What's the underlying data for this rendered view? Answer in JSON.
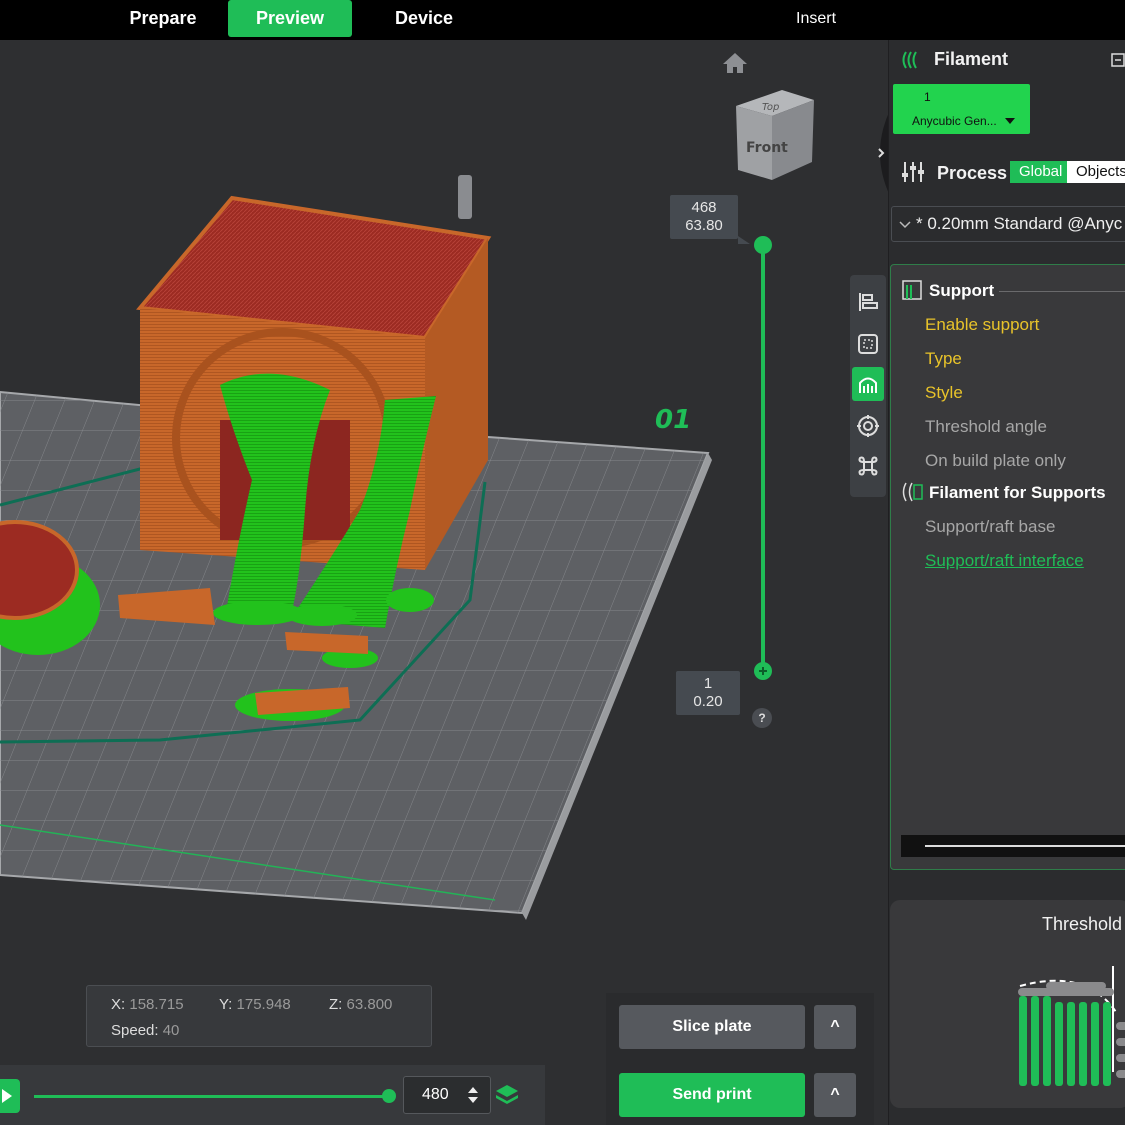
{
  "tabs": [
    {
      "label": "Prepare",
      "active": false
    },
    {
      "label": "Preview",
      "active": true
    },
    {
      "label": "Device",
      "active": false
    }
  ],
  "insert_label": "Insert",
  "viewcube": {
    "top": "Top",
    "front": "Front"
  },
  "plate_label": "01",
  "layer_slider": {
    "top_layer": "468",
    "top_height": "63.80",
    "bottom_layer": "1",
    "bottom_height": "0.20",
    "help": "?"
  },
  "coords": {
    "x_label": "X:",
    "x": "158.715",
    "y_label": "Y:",
    "y": "175.948",
    "z_label": "Z:",
    "z": "63.800",
    "speed_label": "Speed:",
    "speed": "40"
  },
  "playback": {
    "move_value": "480",
    "progress": 1.0
  },
  "buttons": {
    "slice": "Slice plate",
    "send": "Send print",
    "more": "^"
  },
  "filament": {
    "title": "Filament",
    "slot_number": "1",
    "slot_name": "Anycubic Gen..."
  },
  "process": {
    "title": "Process",
    "global": "Global",
    "objects": "Objects",
    "preset": "* 0.20mm Standard @Anyc"
  },
  "support": {
    "title": "Support",
    "options": [
      "Enable support",
      "Type",
      "Style",
      "Threshold angle",
      "On build plate only"
    ],
    "filament_title": "Filament for Supports",
    "filament_options": [
      "Support/raft base",
      "Support/raft interface"
    ]
  },
  "threshold_preview": {
    "title": "Threshold"
  },
  "colors": {
    "accent": "#1fbd57",
    "support_green": "#22c21c",
    "model_orange": "#c8672a",
    "top_red": "#9c2b22",
    "highlight_yellow": "#e8c32a"
  }
}
